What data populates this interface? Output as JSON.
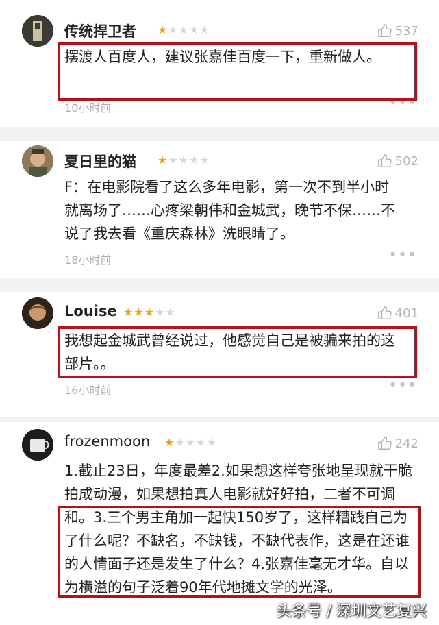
{
  "reviews": [
    {
      "username": "传统捍卫者",
      "rating": 1,
      "likes": "537",
      "text": "摆渡人百度人，建议张嘉佳百度一下，重新做人。",
      "time": "10小时前"
    },
    {
      "username": "夏日里的猫",
      "rating": 1,
      "likes": "502",
      "text": "F：在电影院看了这么多年电影，第一次不到半小时就离场了……心疼梁朝伟和金城武，晚节不保……不说了我去看《重庆森林》洗眼睛了。",
      "time": "18小时前"
    },
    {
      "username": "Louise",
      "rating": 3,
      "likes": "401",
      "text": "我想起金城武曾经说过，他感觉自己是被骗来拍的这部片。。",
      "time": "16小时前"
    },
    {
      "username": "frozenmoon",
      "rating": 1,
      "likes": "242",
      "text": "1.截止23日，年度最差2.如果想这样夸张地呈现就干脆拍成动漫，如果想拍真人电影就好好拍，二者不可调和。3.三个男主角加一起快150岁了，这样糟践自己为了什么呢？不缺名，不缺钱，不缺代表作，这是在还谁的人情面子还是发生了什么？4.张嘉佳毫无才华。自以为横溢的句子泛着90年代地摊文学的光泽。"
    }
  ],
  "more_glyph": "•••",
  "watermark": "头条号 / 深圳文艺复兴",
  "colors": {
    "star": "#f3a11a",
    "highlight": "#b3111b"
  }
}
